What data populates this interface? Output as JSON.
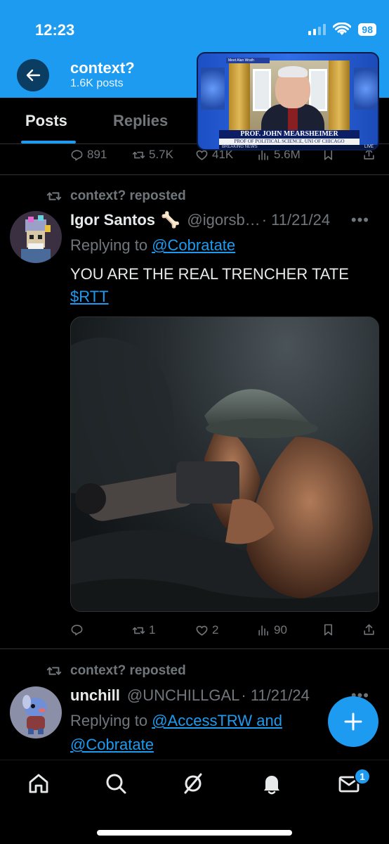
{
  "status_bar": {
    "time": "12:23",
    "battery": "98"
  },
  "header": {
    "title": "context?",
    "subtitle": "1.6K posts"
  },
  "tabs": [
    {
      "label": "Posts",
      "active": true
    },
    {
      "label": "Replies",
      "active": false
    }
  ],
  "pip_video": {
    "name_caption": "PROF. JOHN MEARSHEIMER",
    "role_caption": "PROF OF POLITICAL SCIENCE, UNI OF CHICAGO",
    "ticker": "BREAKING NEWS",
    "live_label": "LIVE",
    "chip_label": "Meet Alan Wrath"
  },
  "previous_post_metrics": {
    "replies": "891",
    "reposts": "5.7K",
    "likes": "41K",
    "views": "5.6M"
  },
  "posts": [
    {
      "repost_label": "context? reposted",
      "author_name": "Igor Santos",
      "author_emoji": "🦴",
      "handle": "@igorsb…",
      "date": "· 11/21/24",
      "reply_prefix": "Replying to",
      "reply_to": "@Cobratate",
      "text": "YOU ARE THE REAL TRENCHER TATE",
      "cashtag": "$RTT",
      "metrics": {
        "replies": "",
        "reposts": "1",
        "likes": "2",
        "views": "90"
      }
    },
    {
      "repost_label": "context? reposted",
      "author_name": "unchill",
      "handle": "@UNCHILLGAL",
      "date": "· 11/21/24",
      "reply_prefix": "Replying to",
      "reply_to_1": "@AccessTRW and",
      "reply_to_2": "@Cobratate"
    }
  ],
  "more_glyph": "•••",
  "nav": {
    "notifications_badge": "1"
  },
  "colors": {
    "accent": "#1d9bf0",
    "background": "#000000",
    "muted": "#71767b"
  },
  "icons": [
    "back-arrow-icon",
    "reply-icon",
    "repost-icon",
    "like-icon",
    "views-icon",
    "bookmark-icon",
    "share-icon",
    "home-icon",
    "search-icon",
    "grok-icon",
    "bell-icon",
    "mail-icon",
    "plus-icon"
  ]
}
